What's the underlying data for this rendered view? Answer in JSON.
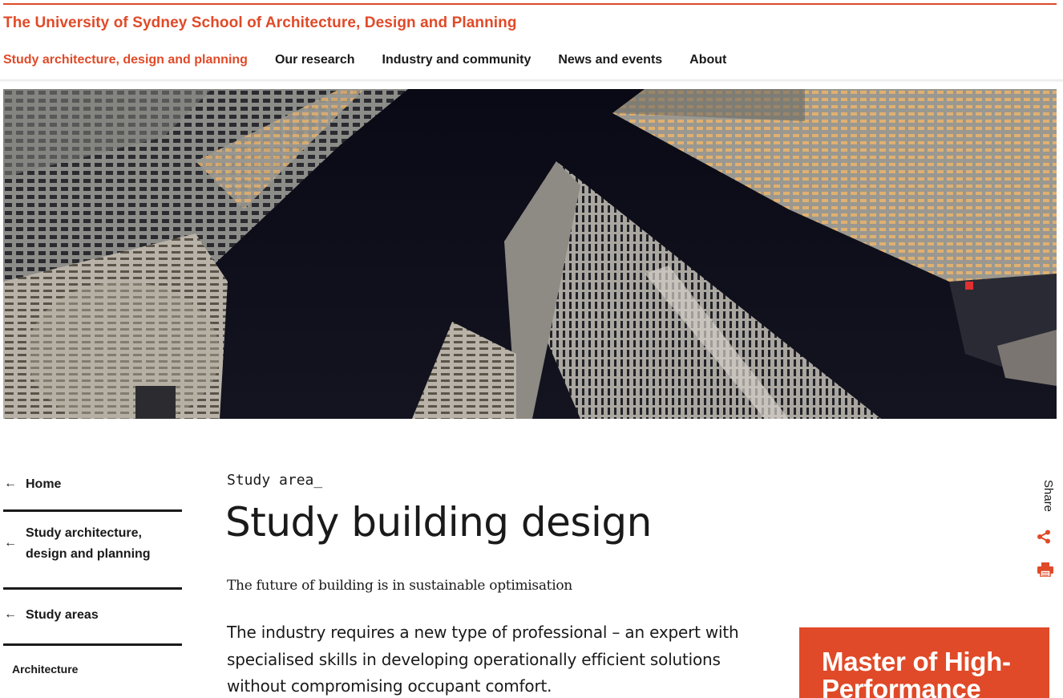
{
  "header": {
    "site_title": "The University of Sydney School of Architecture, Design and Planning",
    "accent_color": "#e04a28"
  },
  "nav": {
    "items": [
      {
        "label": "Study architecture, design and planning",
        "active": true
      },
      {
        "label": "Our research",
        "active": false
      },
      {
        "label": "Industry and community",
        "active": false
      },
      {
        "label": "News and events",
        "active": false
      },
      {
        "label": "About",
        "active": false
      }
    ]
  },
  "hero": {
    "icon": "skyscrapers-at-night-photo"
  },
  "side_nav": {
    "arrow": "←",
    "links": [
      {
        "label": "Home"
      },
      {
        "label": "Study architecture, design and planning"
      },
      {
        "label": "Study areas"
      }
    ],
    "sub_items": [
      {
        "label": "Architecture"
      }
    ]
  },
  "content": {
    "eyebrow": "Study area_",
    "title": "Study building design",
    "tagline": "The future of building is in sustainable optimisation",
    "intro": "The industry requires a new type of professional – an expert with specialised skills in developing operationally efficient solutions without compromising occupant comfort."
  },
  "share": {
    "label": "Share",
    "share_icon": "share-icon",
    "print_icon": "print-icon"
  },
  "promo": {
    "title": "Master of High-Performance Buildings"
  }
}
